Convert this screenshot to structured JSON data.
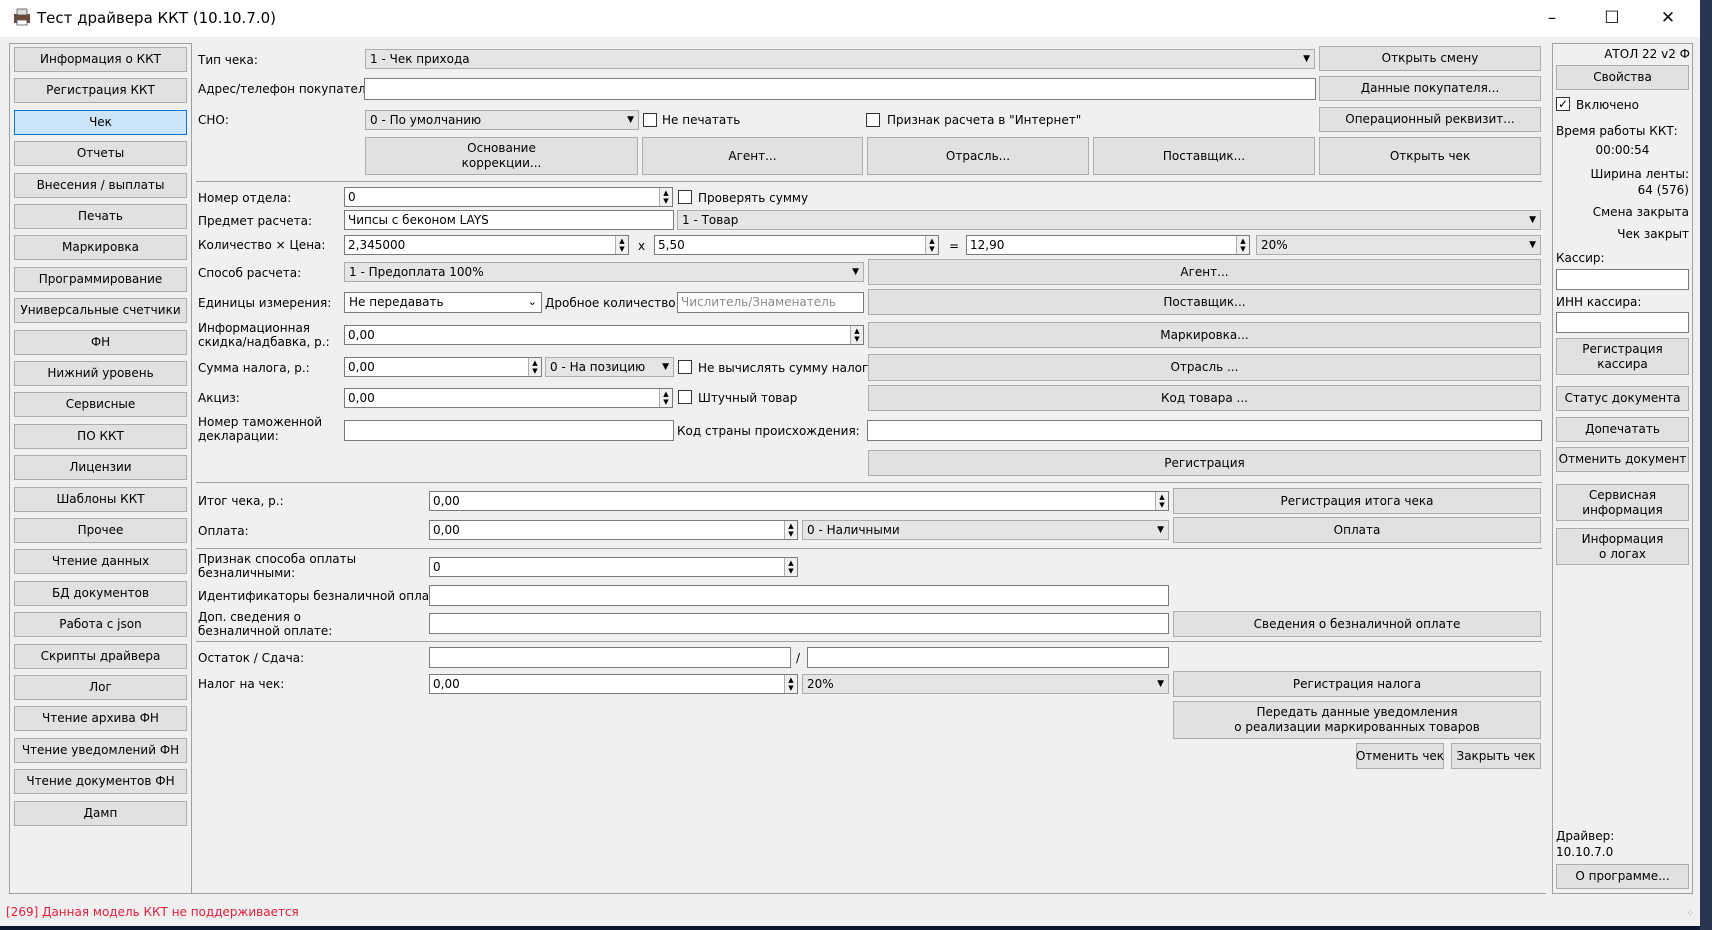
{
  "window": {
    "title": "Тест драйвера ККТ (10.10.7.0)"
  },
  "sidebar": {
    "items": [
      {
        "label": "Информация о ККТ"
      },
      {
        "label": "Регистрация ККТ"
      },
      {
        "label": "Чек",
        "selected": true
      },
      {
        "label": "Отчеты"
      },
      {
        "label": "Внесения / выплаты"
      },
      {
        "label": "Печать"
      },
      {
        "label": "Маркировка"
      },
      {
        "label": "Программирование"
      },
      {
        "label": "Универсальные счетчики"
      },
      {
        "label": "ФН"
      },
      {
        "label": "Нижний уровень"
      },
      {
        "label": "Сервисные"
      },
      {
        "label": "ПО ККТ"
      },
      {
        "label": "Лицензии"
      },
      {
        "label": "Шаблоны ККТ"
      },
      {
        "label": "Прочее"
      },
      {
        "label": "Чтение данных"
      },
      {
        "label": "БД документов"
      },
      {
        "label": "Работа с json"
      },
      {
        "label": "Скрипты драйвера"
      },
      {
        "label": "Лог"
      },
      {
        "label": "Чтение архива ФН"
      },
      {
        "label": "Чтение уведомлений ФН"
      },
      {
        "label": "Чтение документов ФН"
      },
      {
        "label": "Дамп"
      }
    ]
  },
  "receipt": {
    "type_label": "Тип чека:",
    "type_value": "1 - Чек прихода",
    "buyer_contact_label": "Адрес/телефон покупателя:",
    "buyer_contact_value": "",
    "sno_label": "СНО:",
    "sno_value": "0 - По умолчанию",
    "no_print_label": "Не печатать",
    "internet_label": "Признак расчета в \"Интернет\"",
    "btn_open_shift": "Открыть смену",
    "btn_buyer_data": "Данные покупателя...",
    "btn_op_requisite": "Операционный реквизит...",
    "btn_correction_1": "Основание",
    "btn_correction_2": "коррекции...",
    "btn_agent": "Агент...",
    "btn_industry": "Отрасль...",
    "btn_supplier": "Поставщик...",
    "btn_open_receipt": "Открыть чек"
  },
  "position": {
    "department_label": "Номер отдела:",
    "department_value": "0",
    "check_sum_label": "Проверять сумму",
    "item_label": "Предмет расчета:",
    "item_value": "Чипсы с беконом LAYS",
    "item_type_value": "1 - Товар",
    "qty_price_label": "Количество × Цена:",
    "qty_value": "2,345000",
    "times": "x",
    "price_value": "5,50",
    "equals": "=",
    "sum_value": "12,90",
    "vat_value": "20%",
    "payment_method_label": "Способ расчета:",
    "payment_method_value": "1 - Предоплата 100%",
    "btn_agent": "Агент...",
    "units_label": "Единицы измерения:",
    "units_value": "Не передавать",
    "fraction_label": "Дробное количество:",
    "fraction_placeholder": "Числитель/Знаменатель",
    "btn_supplier": "Поставщик...",
    "discount_label_1": "Информационная",
    "discount_label_2": "скидка/надбавка, р.:",
    "discount_value": "0,00",
    "btn_marking": "Маркировка...",
    "tax_sum_label": "Сумма налога, р.:",
    "tax_sum_value": "0,00",
    "tax_mode_value": "0 - На позицию",
    "no_calc_tax_label": "Не вычислять сумму налога",
    "btn_industry": "Отрасль ...",
    "excise_label": "Акциз:",
    "excise_value": "0,00",
    "piece_label": "Штучный товар",
    "btn_product_code": "Код товара ...",
    "customs_label_1": "Номер таможенной",
    "customs_label_2": "декларации:",
    "customs_value": "",
    "country_label": "Код страны происхождения:",
    "country_value": "",
    "btn_register": "Регистрация"
  },
  "totals": {
    "total_label": "Итог чека, р.:",
    "total_value": "0,00",
    "btn_register_total": "Регистрация итога чека",
    "payment_label": "Оплата:",
    "payment_value": "0,00",
    "payment_type_value": "0 - Наличными",
    "btn_payment": "Оплата",
    "cashless_sign_label_1": "Признак способа оплаты",
    "cashless_sign_label_2": "безналичными:",
    "cashless_sign_value": "0",
    "cashless_ids_label": "Идентификаторы безналичной оплаты:",
    "cashless_ids_value": "",
    "cashless_extra_label_1": "Доп. сведения о",
    "cashless_extra_label_2": "безналичной оплате:",
    "cashless_extra_value": "",
    "btn_cashless_info": "Сведения о безналичной оплате",
    "change_label": "Остаток / Сдача:",
    "change_slash": "/",
    "receipt_tax_label": "Налог на чек:",
    "receipt_tax_value": "0,00",
    "receipt_tax_rate": "20%",
    "btn_register_tax": "Регистрация налога",
    "btn_notify_1": "Передать данные уведомления",
    "btn_notify_2": "о реализации маркированных товаров",
    "btn_cancel_receipt": "Отменить чек",
    "btn_close_receipt": "Закрыть чек"
  },
  "right_panel": {
    "model": "АТОЛ 22 v2 Ф",
    "btn_properties": "Свойства",
    "enabled_label": "Включено",
    "uptime_label": "Время работы ККТ:",
    "uptime_value": "00:00:54",
    "tape_width_label": "Ширина ленты:",
    "tape_width_value": "64 (576)",
    "shift_status": "Смена закрыта",
    "receipt_status": "Чек закрыт",
    "cashier_label": "Кассир:",
    "cashier_inn_label": "ИНН кассира:",
    "btn_register_cashier_1": "Регистрация",
    "btn_register_cashier_2": "кассира",
    "btn_doc_status": "Статус документа",
    "btn_reprint": "Допечатать",
    "btn_cancel_doc": "Отменить документ",
    "btn_service_info_1": "Сервисная",
    "btn_service_info_2": "информация",
    "btn_log_info_1": "Информация",
    "btn_log_info_2": "о логах",
    "driver_label": "Драйвер:",
    "driver_version": "10.10.7.0",
    "btn_about": "О программе..."
  },
  "status_bar": {
    "message": "[269] Данная модель ККТ не поддерживается"
  }
}
